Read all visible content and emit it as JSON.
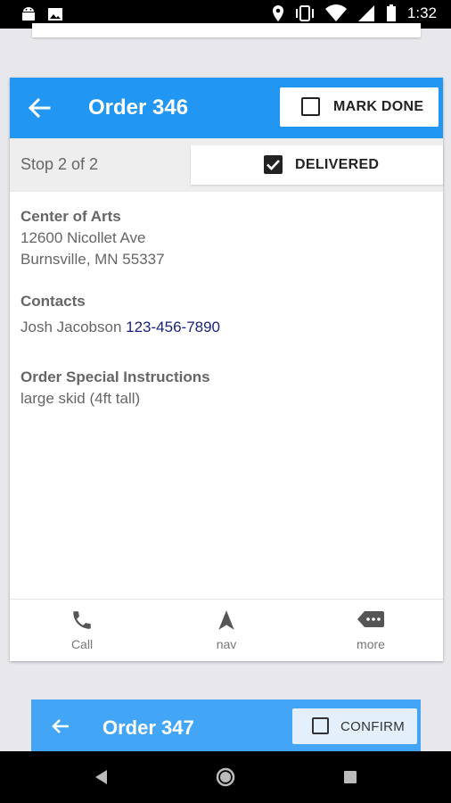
{
  "status_bar": {
    "time": "1:32",
    "icons": [
      "android-icon",
      "image-icon",
      "location-icon",
      "vibrate-icon",
      "wifi-icon",
      "signal-icon",
      "battery-icon"
    ]
  },
  "order": {
    "title": "Order 346",
    "mark_done_label": "MARK DONE",
    "mark_done_checked": false,
    "stop_label": "Stop 2 of 2",
    "delivered_label": "DELIVERED",
    "delivered_checked": true
  },
  "location": {
    "name": "Center of Arts",
    "address_line1": "12600 Nicollet Ave",
    "address_line2": "Burnsville, MN 55337"
  },
  "contacts": {
    "heading": "Contacts",
    "name": "Josh Jacobson",
    "phone": "123-456-7890"
  },
  "instructions": {
    "heading": "Order Special Instructions",
    "text": "large skid (4ft tall)"
  },
  "bottom_nav": [
    {
      "label": "Call",
      "icon": "phone-icon"
    },
    {
      "label": "nav",
      "icon": "navigation-icon"
    },
    {
      "label": "more",
      "icon": "more-icon"
    }
  ],
  "next_order": {
    "title": "Order 347",
    "confirm_label": "CONFIRM"
  },
  "colors": {
    "header_blue": "#2196f3",
    "next_header_blue": "#42a5f5",
    "phone_link": "#1a237e"
  }
}
